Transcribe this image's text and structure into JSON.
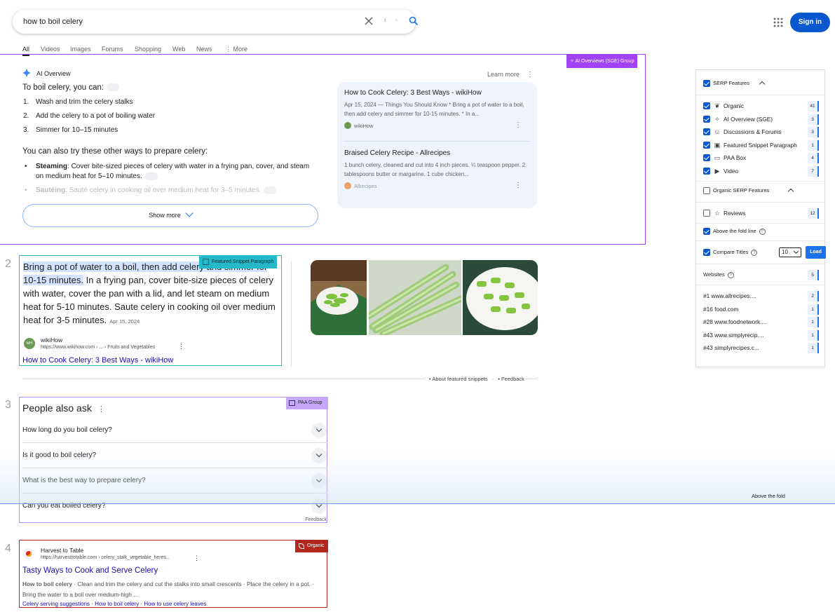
{
  "search": {
    "query": "how to boil celery"
  },
  "header": {
    "signin": "Sign in"
  },
  "tabs": [
    "All",
    "Videos",
    "Images",
    "Forums",
    "Shopping",
    "Web",
    "News",
    "More"
  ],
  "ai_overview": {
    "badge": "AI Overviews (SGE) Group",
    "title": "AI Overview",
    "learn_more": "Learn more",
    "intro": "To boil celery, you can:",
    "steps": [
      "Wash and trim the celery stalks",
      "Add the celery to a pot of boiling water",
      "Simmer for 10–15 minutes"
    ],
    "subheading": "You can also try these other ways to prepare celery:",
    "bullets": [
      {
        "term": "Steaming",
        "text": ": Cover bite-sized pieces of celery with water in a frying pan, cover, and steam on medium heat for 5–10 minutes."
      },
      {
        "term": "Sautéing",
        "text": ": Sauté celery in cooking oil over medium heat for 3–5 minutes."
      }
    ],
    "show_more": "Show more",
    "sources": [
      {
        "title": "How to Cook Celery: 3 Best Ways - wikiHow",
        "desc": "Apr 15, 2024 — Things You Should Know * Bring a pot of water to a boil, then add celery and simmer for 10-15 minutes. * In a...",
        "site": "wikiHow"
      },
      {
        "title": "Braised Celery Recipe - Allrecipes",
        "desc": "1 bunch celery, cleaned and cut into 4 inch pieces. ¼ teaspoon pepper. 2 tablespoons butter or margarine. 1 cube chicken...",
        "site": "Allrecipes"
      }
    ]
  },
  "featured_snippet": {
    "rank": "2",
    "badge": "Featured Snippet Paragraph",
    "highlight": "Bring a pot of water to a boil, then add celery and simmer for 10-15 minutes.",
    "text": " In a frying pan, cover bite-size pieces of celery with water, cover the pan with a lid, and let steam on medium heat for 5-10 minutes. Saute celery in cooking oil over medium heat for 3-5 minutes.",
    "date": "Apr 15, 2024",
    "fav_text": "wH",
    "site": "wikiHow",
    "url": "https://www.wikihow.com › ... › Fruits and Vegetables",
    "link": "How to Cook Celery: 3 Best Ways - wikiHow",
    "about": "About featured snippets",
    "feedback": "Feedback"
  },
  "paa": {
    "rank": "3",
    "badge": "PAA Group",
    "title": "People also ask",
    "questions": [
      "How long do you boil celery?",
      "Is it good to boil celery?",
      "What is the best way to prepare celery?",
      "Can you eat boiled celery?"
    ],
    "feedback": "Feedback"
  },
  "fold": {
    "label": "Above the fold"
  },
  "organic": {
    "rank": "4",
    "badge": "Organic",
    "site": "Harvest to Table",
    "url": "https://harvesttotable.com › celery_stalk_vegetable_heres...",
    "link": "Tasty Ways to Cook and Serve Celery",
    "desc_bold": "How to boil celery",
    "desc": " · Clean and trim the celery and cut the stalks into small crescents · Place the celery in a pot. · Bring the water to a boil over medium-high ...",
    "sitelinks": "Celery serving suggestions · How to boil celery · How to use celery leaves"
  },
  "panel": {
    "serp_features": "SERP Features",
    "features": [
      {
        "label": "Organic",
        "count": "41",
        "icon": "leaf-icon"
      },
      {
        "label": "AI Overview (SGE)",
        "count": "3",
        "icon": "sparkle-icon"
      },
      {
        "label": "Discussions & Forums",
        "count": "3",
        "icon": "chat-icon"
      },
      {
        "label": "Featured Snippet Paragraph",
        "count": "1",
        "icon": "snippet-icon"
      },
      {
        "label": "PAA Box",
        "count": "4",
        "icon": "paa-icon"
      },
      {
        "label": "Video",
        "count": "7",
        "icon": "video-icon"
      }
    ],
    "organic_serp_features": "Organic SERP Features",
    "reviews": {
      "label": "Reviews",
      "count": "12"
    },
    "above_fold": "Above the fold line",
    "compare_titles": "Compare Titles",
    "compare_value": "10",
    "load": "Load",
    "websites": "Websites",
    "websites_count": "5",
    "sites": [
      {
        "label": "#1  www.allrecipes....",
        "count": "2"
      },
      {
        "label": "#16  food.com",
        "count": "1"
      },
      {
        "label": "#28  www.foodnetwork....",
        "count": "1"
      },
      {
        "label": "#43  www.simplyrecip....",
        "count": "1"
      },
      {
        "label": "#43  simplyrecipes.c...",
        "count": "1"
      }
    ]
  }
}
